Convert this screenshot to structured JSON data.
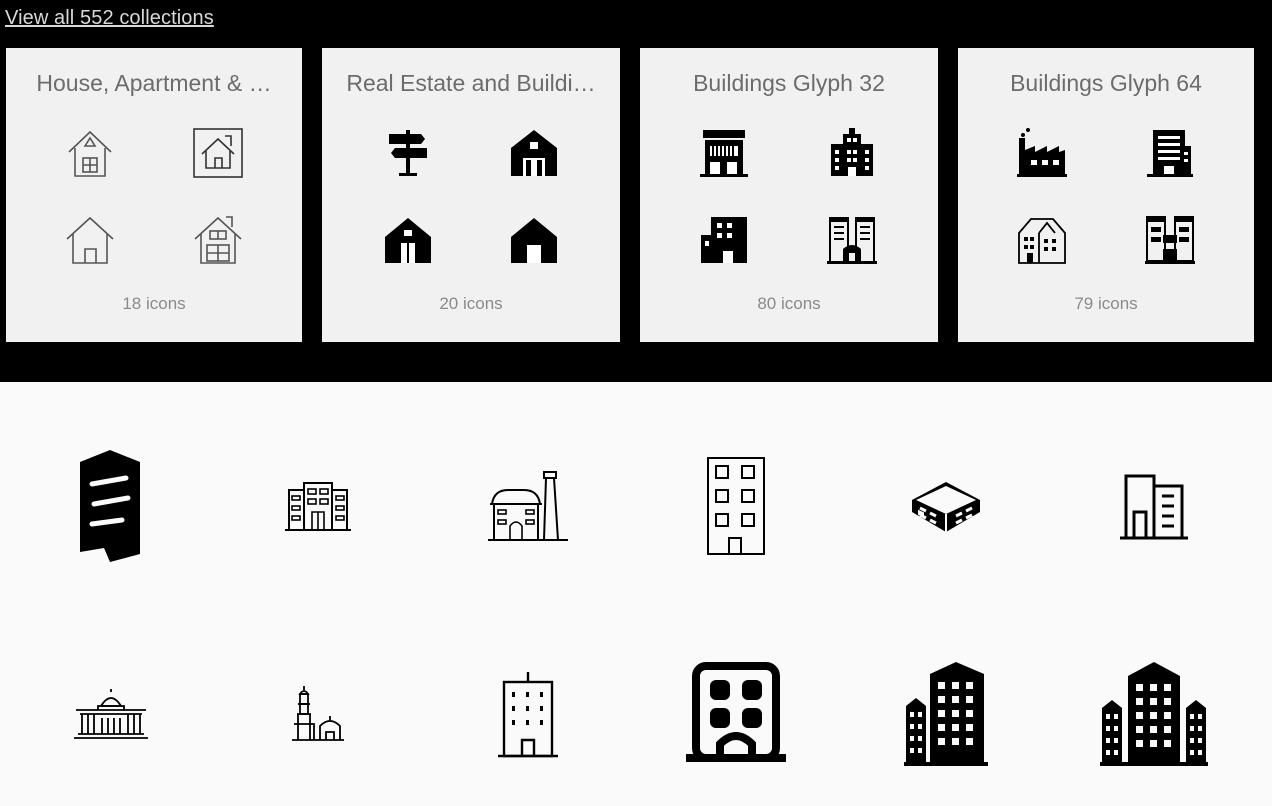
{
  "header": {
    "view_all_label": "View all 552 collections"
  },
  "collections": [
    {
      "title": "House, Apartment & …",
      "count_label": "18 icons",
      "icons": [
        "house-attic-icon",
        "house-framed-icon",
        "house-outline-icon",
        "house-windows-icon"
      ]
    },
    {
      "title": "Real Estate and Buildi…",
      "count_label": "20 icons",
      "icons": [
        "signpost-icon",
        "barn-icon",
        "house-door-icon",
        "garage-icon"
      ]
    },
    {
      "title": "Buildings Glyph 32",
      "count_label": "80 icons",
      "icons": [
        "storefront-icon",
        "office-building-icon",
        "block-building-icon",
        "twin-towers-icon"
      ]
    },
    {
      "title": "Buildings Glyph 64",
      "count_label": "79 icons",
      "icons": [
        "factory-icon",
        "skyscraper-icon",
        "townhouse-icon",
        "bridge-building-icon"
      ]
    }
  ],
  "icon_grid": [
    "modern-tower-icon",
    "office-block-icon",
    "factory-chimney-icon",
    "apartment-outline-icon",
    "isometric-building-icon",
    "office-tower-icon",
    "capitol-building-icon",
    "mosque-minaret-icon",
    "highrise-icon",
    "hotel-icon",
    "city-buildings-icon",
    "city-skyline-icon"
  ]
}
